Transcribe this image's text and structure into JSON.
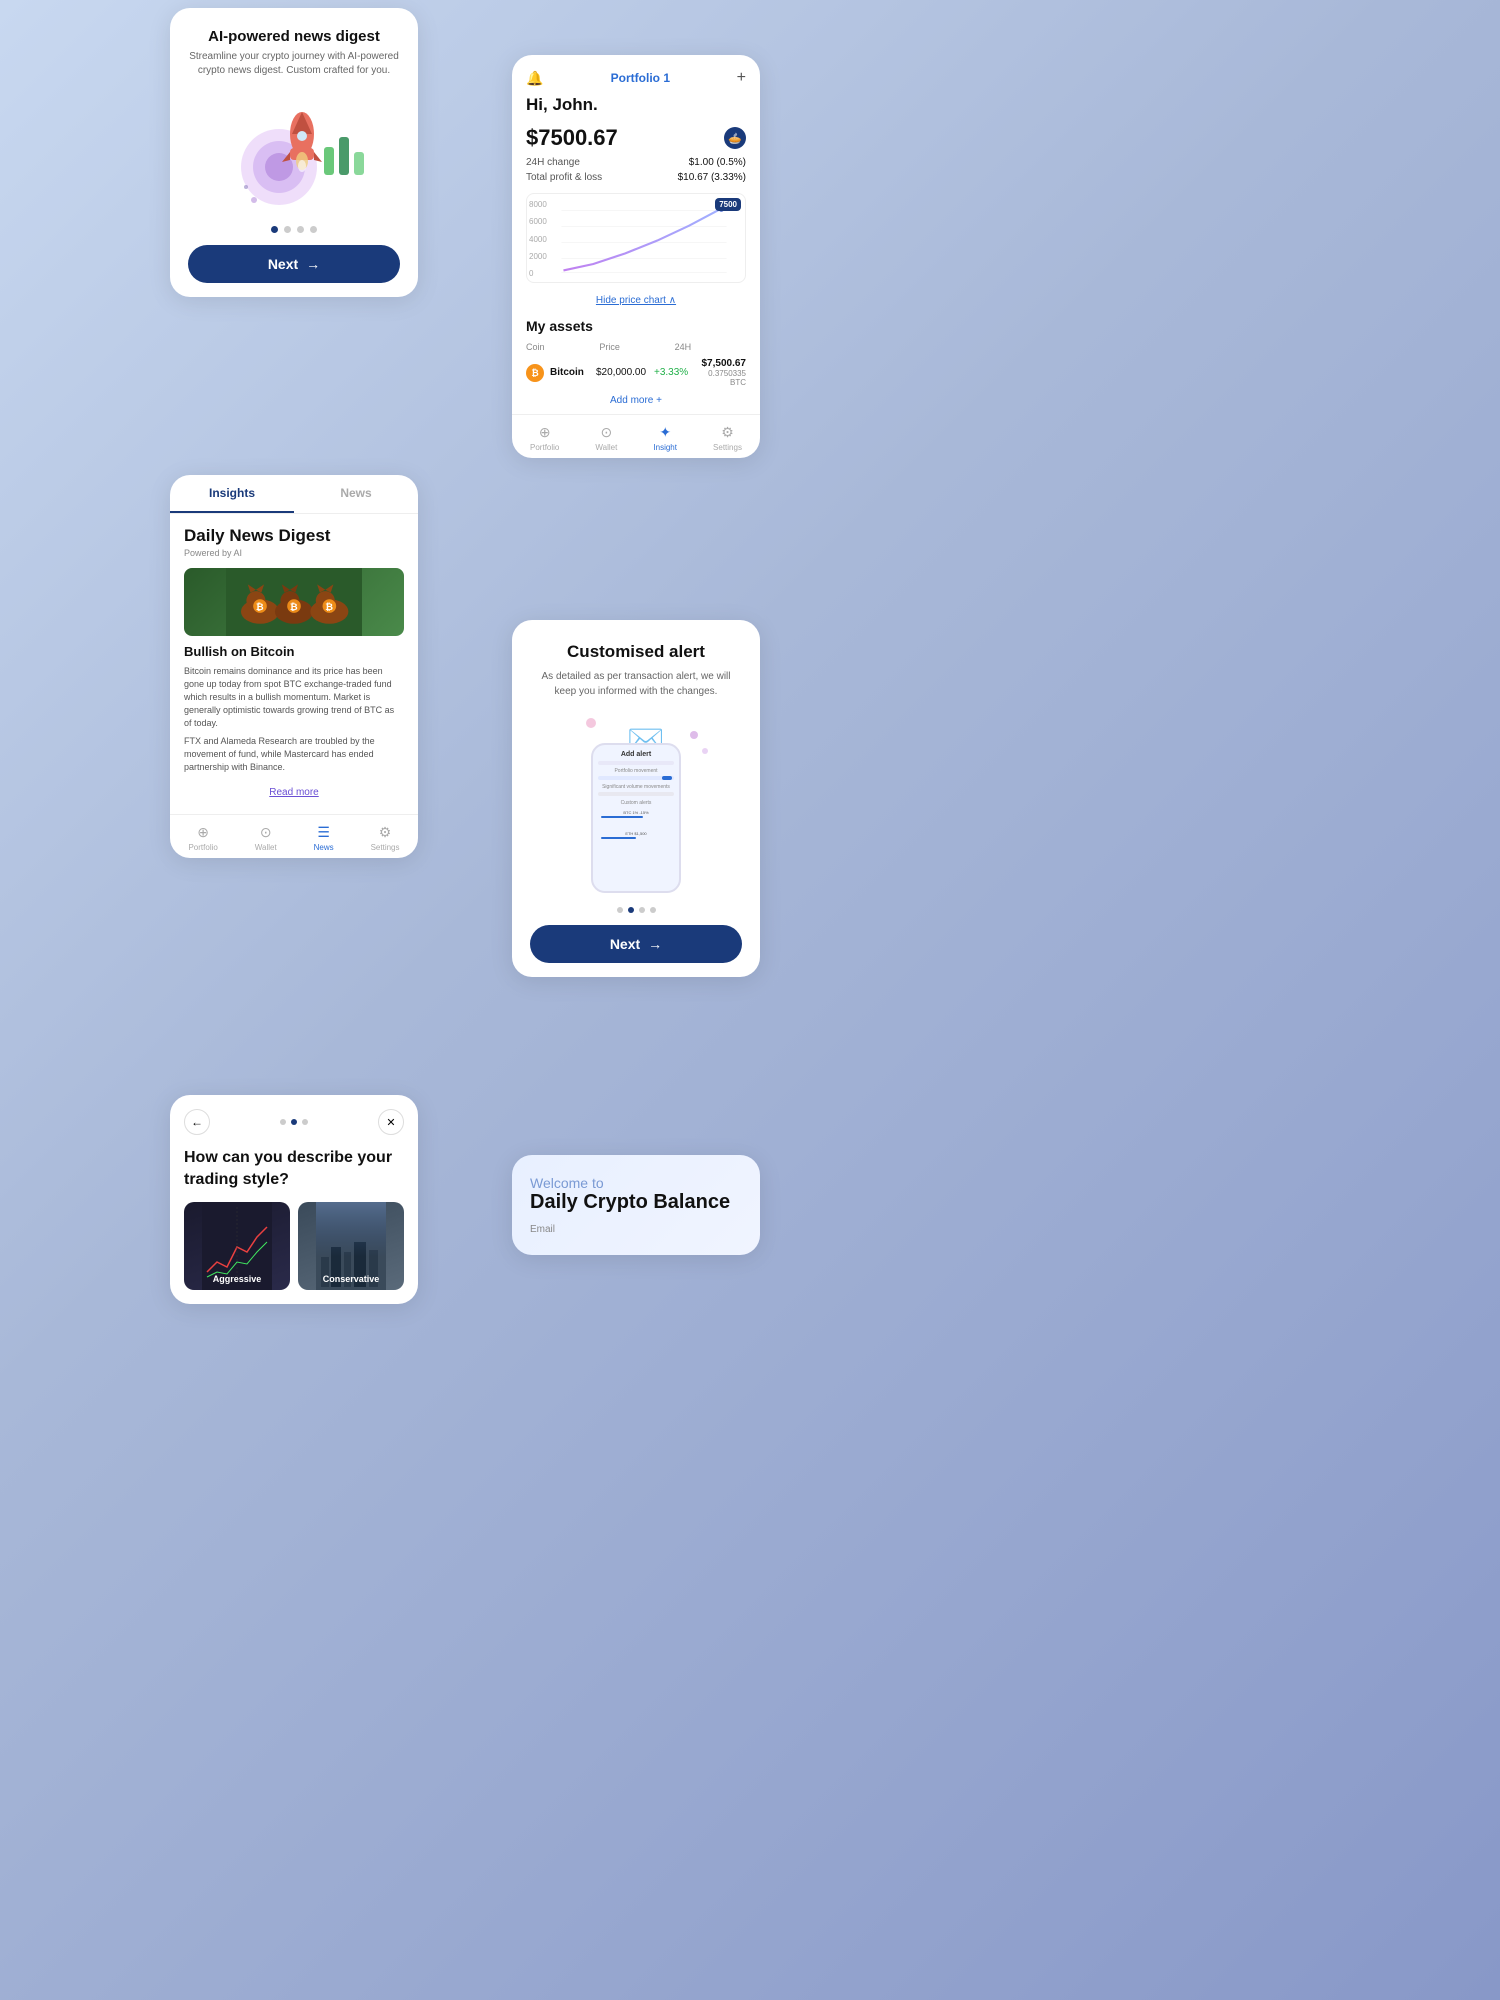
{
  "card_ai_news": {
    "title": "AI-powered news digest",
    "subtitle": "Streamline your crypto journey with AI-powered crypto news digest. Custom crafted for you.",
    "dots": [
      true,
      false,
      false,
      false
    ],
    "next_label": "Next",
    "next_arrow": "→"
  },
  "card_portfolio": {
    "header_bell": "🔔",
    "portfolio_title": "Portfolio 1",
    "plus_icon": "+",
    "greeting": "Hi, John.",
    "value": "$7500.67",
    "change_label": "24H change",
    "change_value": "$1.00 (0.5%)",
    "pnl_label": "Total profit & loss",
    "pnl_value": "$10.67 (3.33%)",
    "chart_badge": "7500",
    "chart_labels": [
      "8000",
      "6000",
      "4000",
      "2000",
      "0"
    ],
    "hide_chart": "Hide price chart",
    "my_assets_title": "My assets",
    "assets_headers": [
      "Coin",
      "Price",
      "24H",
      ""
    ],
    "asset_coin_icon": "₿",
    "asset_coin_name": "Bitcoin",
    "asset_coin_label": "Coin",
    "asset_price": "$20,000.00",
    "asset_change": "+3.33%",
    "asset_value": "$7,500.67",
    "asset_btc": "0.3750335 BTC",
    "add_more": "Add more +",
    "nav_items": [
      {
        "label": "Portfolio",
        "icon": "⊕",
        "active": false
      },
      {
        "label": "Wallet",
        "icon": "⊙",
        "active": false
      },
      {
        "label": "Insight",
        "icon": "✦",
        "active": true
      },
      {
        "label": "Settings",
        "icon": "⚙",
        "active": false
      }
    ]
  },
  "card_insights": {
    "tabs": [
      {
        "label": "Insights",
        "active": true
      },
      {
        "label": "News",
        "active": false
      }
    ],
    "digest_title": "Daily News Digest",
    "digest_subtitle": "Powered by AI",
    "news_headline": "Bullish on Bitcoin",
    "news_body_1": "Bitcoin remains dominance and its price has been gone up today from spot BTC exchange-traded fund which results in a bullish momentum. Market is generally optimistic towards growing trend of BTC as of today.",
    "news_body_2": "FTX and Alameda Research are troubled by the movement of fund, while Mastercard has ended partnership with Binance.",
    "read_more": "Read more",
    "nav_items": [
      {
        "label": "Portfolio",
        "icon": "⊕",
        "active": false
      },
      {
        "label": "Wallet",
        "icon": "⊙",
        "active": false
      },
      {
        "label": "News",
        "icon": "☰",
        "active": true
      },
      {
        "label": "Settings",
        "icon": "⚙",
        "active": false
      }
    ]
  },
  "card_alert": {
    "title": "Customised alert",
    "subtitle": "As detailed as per transaction alert, we will keep you informed with the changes.",
    "dots": [
      false,
      true,
      false,
      false
    ],
    "next_label": "Next",
    "next_arrow": "→"
  },
  "card_trading": {
    "back_icon": "←",
    "close_icon": "✕",
    "dots": [
      false,
      true,
      false
    ],
    "question": "How can you describe your trading style?",
    "options": [
      {
        "label": "Aggressive"
      },
      {
        "label": "Conservative"
      }
    ]
  },
  "card_welcome": {
    "welcome_to": "Welcome to",
    "title": "Daily Crypto Balance",
    "email_label": "Email"
  }
}
